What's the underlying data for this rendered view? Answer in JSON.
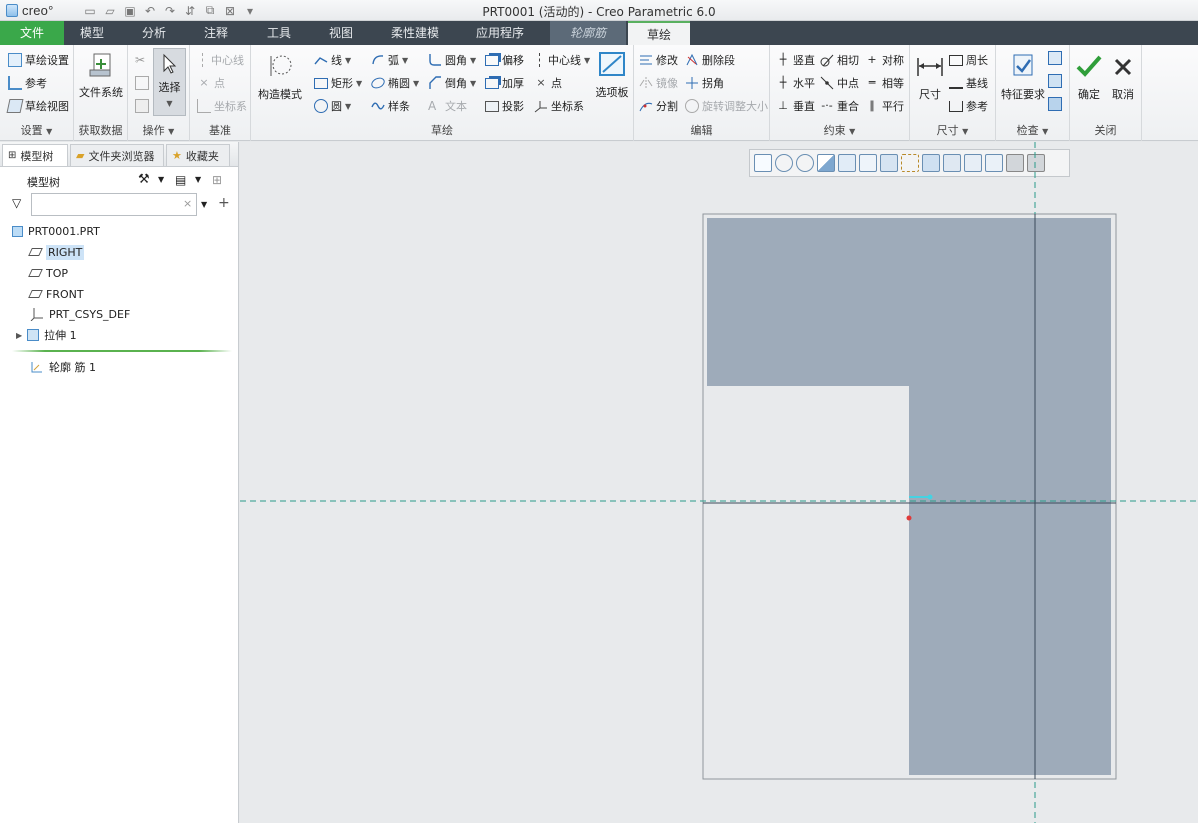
{
  "app": {
    "logo_text": "creo°",
    "window_title": "PRT0001 (活动的) - Creo Parametric 6.0"
  },
  "tabs": [
    {
      "label": "文件"
    },
    {
      "label": "模型"
    },
    {
      "label": "分析"
    },
    {
      "label": "注释"
    },
    {
      "label": "工具"
    },
    {
      "label": "视图"
    },
    {
      "label": "柔性建模"
    },
    {
      "label": "应用程序"
    },
    {
      "label": "轮廓筋"
    },
    {
      "label": "草绘"
    }
  ],
  "ribbon": {
    "setup": {
      "label": "设置",
      "items": [
        "草绘设置",
        "参考",
        "草绘视图"
      ]
    },
    "get_data": {
      "label": "获取数据",
      "file_system": "文件系统"
    },
    "operations": {
      "label": "操作",
      "select": "选择"
    },
    "datum": {
      "label": "基准",
      "items": [
        "中心线",
        "点",
        "坐标系"
      ]
    },
    "sketch": {
      "label": "草绘",
      "construction": "构造模式",
      "col1": [
        "线",
        "矩形",
        "圆"
      ],
      "col2": [
        "弧",
        "椭圆",
        "样条"
      ],
      "col3": [
        "圆角",
        "倒角",
        "文本"
      ],
      "col4": [
        "偏移",
        "加厚",
        "投影"
      ],
      "col5": [
        "中心线",
        "点",
        "坐标系"
      ],
      "palette": "选项板"
    },
    "edit": {
      "label": "编辑",
      "items": [
        "修改",
        "删除段",
        "镜像",
        "拐角",
        "分割",
        "旋转调整大小"
      ]
    },
    "constrain": {
      "label": "约束",
      "items": [
        "竖直",
        "相切",
        "对称",
        "水平",
        "中点",
        "相等",
        "垂直",
        "重合",
        "平行"
      ]
    },
    "dimension": {
      "label": "尺寸",
      "dim": "尺寸",
      "items": [
        "周长",
        "基线",
        "参考"
      ]
    },
    "inspect": {
      "label": "检查",
      "feature_req": "特征要求"
    },
    "close": {
      "label": "关闭",
      "ok": "确定",
      "cancel": "取消"
    }
  },
  "left_panel": {
    "tabs": [
      "模型树",
      "文件夹浏览器",
      "收藏夹"
    ],
    "tree_label": "模型树",
    "search_placeholder": "",
    "tree": [
      {
        "label": "PRT0001.PRT"
      },
      {
        "label": "RIGHT"
      },
      {
        "label": "TOP"
      },
      {
        "label": "FRONT"
      },
      {
        "label": "PRT_CSYS_DEF"
      },
      {
        "label": "拉伸 1"
      },
      {
        "label": "轮廓 筋 1"
      }
    ]
  },
  "colors": {
    "tab_bar": "#3c4650",
    "file_tab": "#3aa84a",
    "section_fill": "#9eabba",
    "axis_line": "#2a9b8a"
  }
}
